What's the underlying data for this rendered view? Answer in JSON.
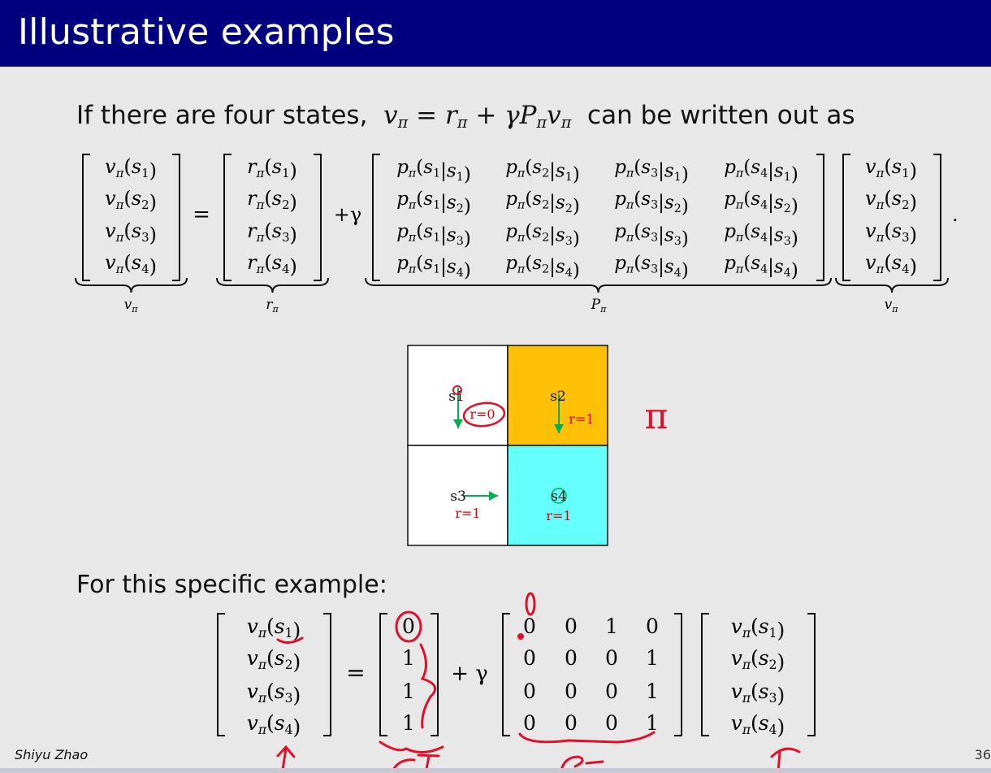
{
  "slide": {
    "title": "Illustrative examples",
    "intro_text": "If there are four states,",
    "intro_suffix": "can be written out as",
    "section2": "For this specific example:",
    "author": "Shiyu Zhao",
    "page_number": "36"
  },
  "equation1": {
    "v_entries": [
      "s1",
      "s2",
      "s3",
      "s4"
    ],
    "labels": {
      "v": "vπ",
      "r": "rπ",
      "P": "Pπ"
    }
  },
  "grid": {
    "cells": [
      {
        "state": "s1",
        "reward": "r=0",
        "color": "#ffffff",
        "action": "down"
      },
      {
        "state": "s2",
        "reward": "r=1",
        "color": "#ffc107",
        "action": "down"
      },
      {
        "state": "s3",
        "reward": "r=1",
        "color": "#ffffff",
        "action": "right"
      },
      {
        "state": "s4",
        "reward": "r=1",
        "color": "#66ffff",
        "action": "stay"
      }
    ],
    "pi_annotation": "π"
  },
  "equation2": {
    "r_values": [
      "0",
      "1",
      "1",
      "1"
    ],
    "P_values": [
      [
        "0",
        "0",
        "1",
        "0"
      ],
      [
        "0",
        "0",
        "0",
        "1"
      ],
      [
        "0",
        "0",
        "0",
        "1"
      ],
      [
        "0",
        "0",
        "0",
        "1"
      ]
    ]
  },
  "colors": {
    "title_bg": "#00007f",
    "arrow": "#00b050",
    "reward": "#e00000",
    "ink": "#e0102a"
  }
}
